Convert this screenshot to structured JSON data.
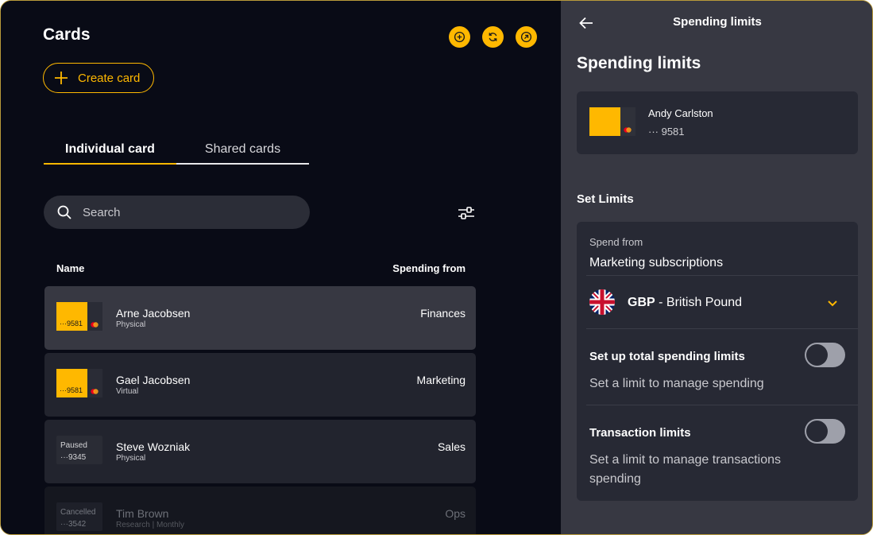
{
  "left": {
    "title": "Cards",
    "header_icons": [
      "plus-circle-icon",
      "refresh-icon",
      "arrow-up-right-icon"
    ],
    "create_button": "Create card",
    "tabs": [
      {
        "label": "Individual card",
        "active": true
      },
      {
        "label": "Shared cards",
        "active": false
      }
    ],
    "search_placeholder": "Search",
    "columns": {
      "name": "Name",
      "spending_from": "Spending from"
    },
    "rows": [
      {
        "name": "Arne Jacobsen",
        "type": "Physical",
        "card_label": "···9581",
        "spending_from": "Finances",
        "state": "active"
      },
      {
        "name": "Gael Jacobsen",
        "type": "Virtual",
        "card_label": "···9581",
        "spending_from": "Marketing",
        "state": "active"
      },
      {
        "name": "Steve Wozniak",
        "type": "Physical",
        "card_status": "Paused",
        "card_label": "···9345",
        "spending_from": "Sales",
        "state": "paused"
      },
      {
        "name": "Tim Brown",
        "type": "Research | Monthly",
        "card_status": "Cancelled",
        "card_label": "···3542",
        "spending_from": "Ops",
        "state": "cancelled"
      }
    ]
  },
  "right": {
    "header_title": "Spending limits",
    "title": "Spending limits",
    "card": {
      "holder": "Andy Carlston",
      "number": "··· 9581"
    },
    "section_title": "Set Limits",
    "spend_from_label": "Spend from",
    "spend_from_value": "Marketing subscriptions",
    "currency_code": "GBP",
    "currency_separator": " - ",
    "currency_name": "British Pound",
    "total_limits": {
      "title": "Set up total spending limits",
      "desc": "Set a limit to manage spending",
      "enabled": false
    },
    "transaction_limits": {
      "title": "Transaction limits",
      "desc": "Set a limit to manage transactions spending",
      "enabled": false
    }
  },
  "colors": {
    "accent": "#ffb800",
    "left_bg": "#090b16",
    "right_bg": "#373842"
  }
}
